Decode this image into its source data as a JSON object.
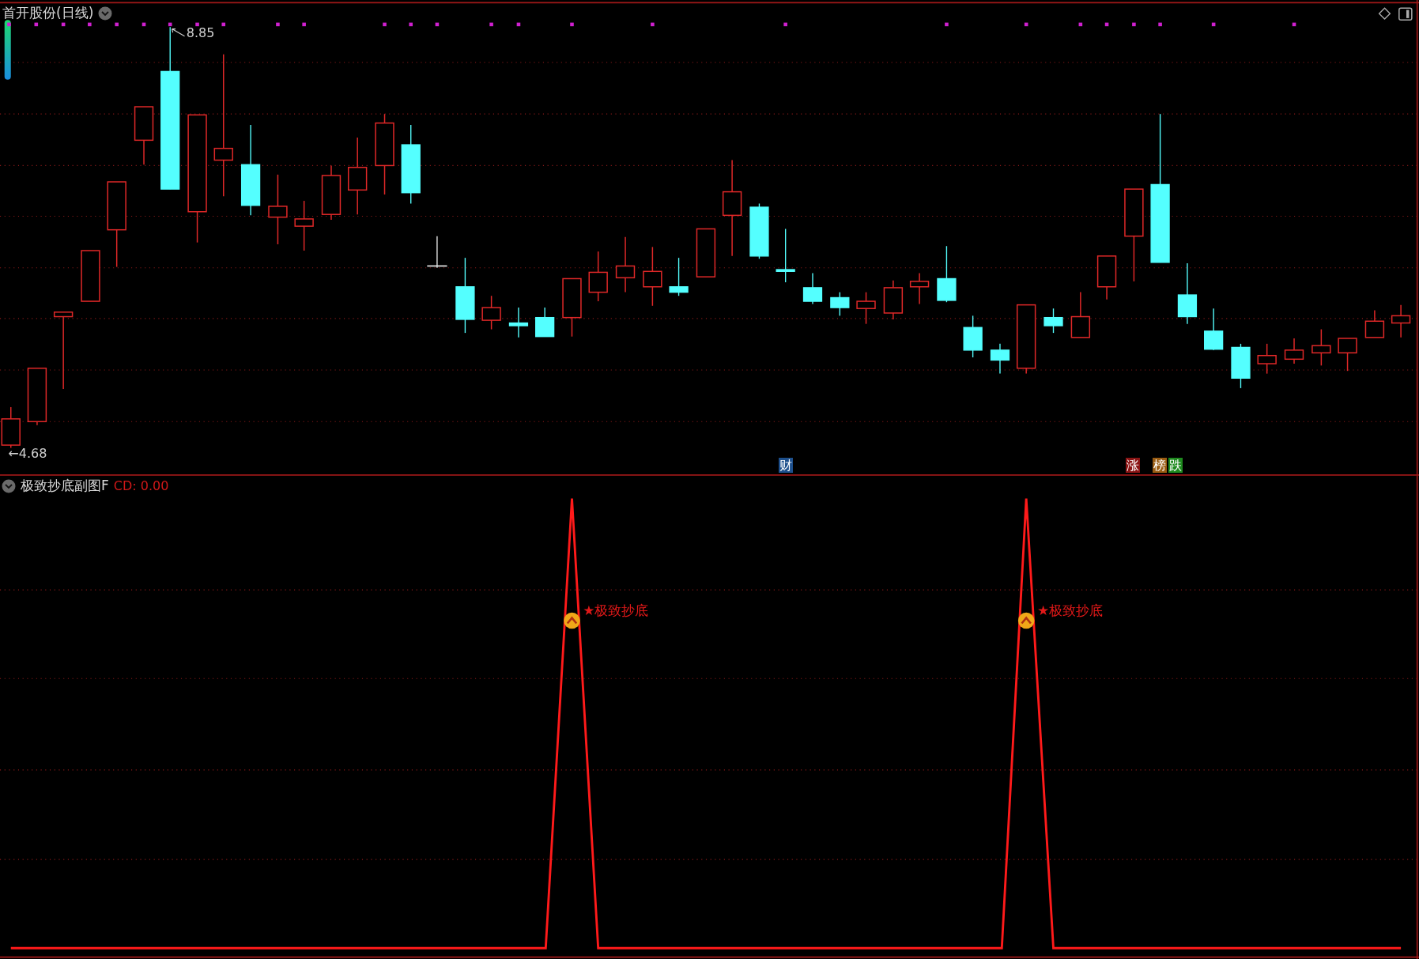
{
  "main_panel": {
    "title": "首开股份(日线)",
    "high_label": "8.85",
    "low_label": "←4.68",
    "events": [
      {
        "text": "财",
        "color": "#1d4f8c"
      },
      {
        "text": "涨",
        "color": "#8a1414"
      },
      {
        "text": "榜",
        "color": "#9a5c12"
      },
      {
        "text": "跌",
        "color": "#1e8a1e"
      }
    ]
  },
  "sub_panel": {
    "title": "极致抄底副图F",
    "reading": "CD: 0.00",
    "signals": [
      {
        "text": "★极致抄底"
      },
      {
        "text": "★极致抄底"
      }
    ]
  }
}
